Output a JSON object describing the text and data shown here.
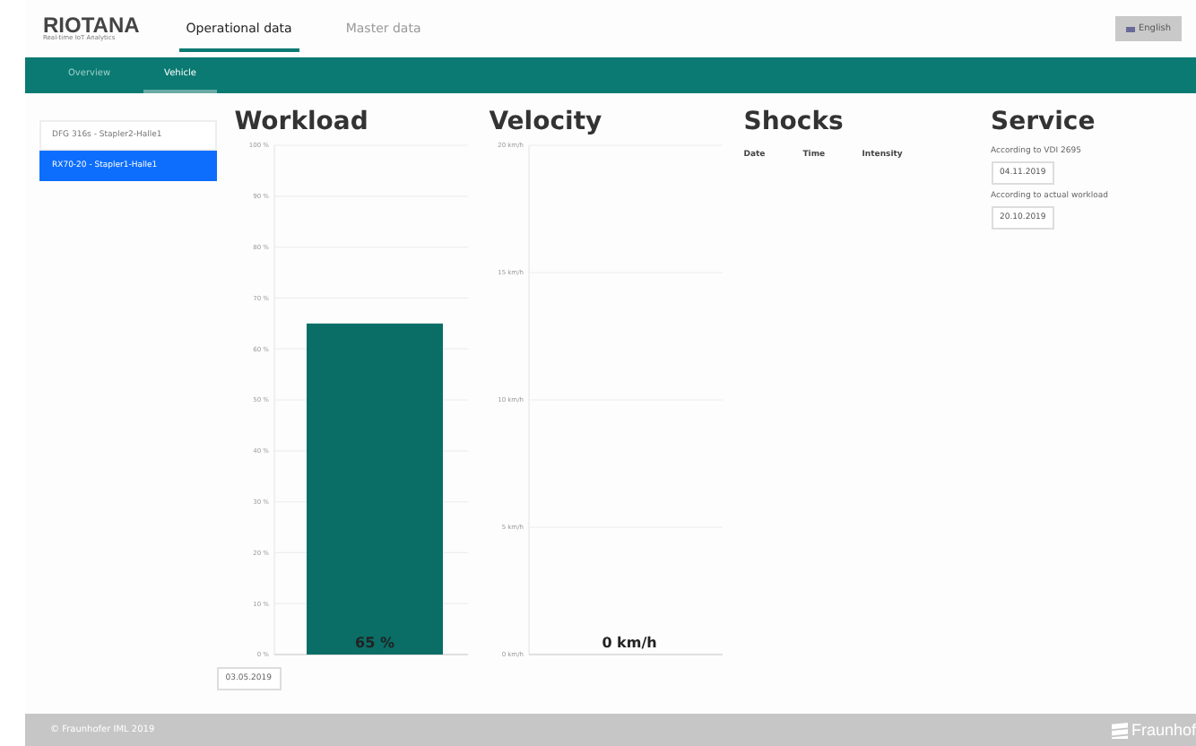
{
  "header": {
    "logo": "RIOTANA",
    "logo_subtitle": "Real-time IoT Analytics",
    "tabs": [
      {
        "label": "Operational data",
        "selected": true
      },
      {
        "label": "Master data",
        "selected": false
      }
    ],
    "language_button": "English"
  },
  "subnav": {
    "tabs": [
      {
        "label": "Overview",
        "selected": false
      },
      {
        "label": "Vehicle",
        "selected": true
      }
    ]
  },
  "sidebar": {
    "items": [
      {
        "label": "DFG 316s - Stapler2-Halle1",
        "selected": false
      },
      {
        "label": "RX70-20 - Stapler1-Halle1",
        "selected": true
      }
    ]
  },
  "workload": {
    "title": "Workload",
    "value_label": "65 %",
    "date": "03.05.2019",
    "chart_data": {
      "type": "bar",
      "grid": true,
      "values": [
        65
      ],
      "ylim": [
        0,
        100
      ],
      "yticks": [
        {
          "value": 0,
          "label": "0 %"
        },
        {
          "value": 10,
          "label": "10 %"
        },
        {
          "value": 20,
          "label": "20 %"
        },
        {
          "value": 30,
          "label": "30 %"
        },
        {
          "value": 40,
          "label": "40 %"
        },
        {
          "value": 50,
          "label": "50 %"
        },
        {
          "value": 60,
          "label": "60 %"
        },
        {
          "value": 70,
          "label": "70 %"
        },
        {
          "value": 80,
          "label": "80 %"
        },
        {
          "value": 90,
          "label": "90 %"
        },
        {
          "value": 100,
          "label": "100 %"
        }
      ]
    }
  },
  "velocity": {
    "title": "Velocity",
    "value_label": "0 km/h",
    "chart_data": {
      "type": "bar",
      "grid": true,
      "values": [
        0
      ],
      "ylim": [
        0,
        20
      ],
      "yticks": [
        {
          "value": 0,
          "label": "0 km/h"
        },
        {
          "value": 5,
          "label": "5 km/h"
        },
        {
          "value": 10,
          "label": "10 km/h"
        },
        {
          "value": 15,
          "label": "15 km/h"
        },
        {
          "value": 20,
          "label": "20 km/h"
        }
      ]
    }
  },
  "shocks": {
    "title": "Shocks",
    "columns": [
      "Date",
      "Time",
      "Intensity"
    ]
  },
  "service": {
    "title": "Service",
    "entries": [
      {
        "label": "According to VDI 2695",
        "date": "04.11.2019"
      },
      {
        "label": "According to actual workload",
        "date": "20.10.2019"
      }
    ]
  },
  "footer": {
    "copyright": "© Fraunhofer IML 2019",
    "logo": "Fraunhof"
  }
}
